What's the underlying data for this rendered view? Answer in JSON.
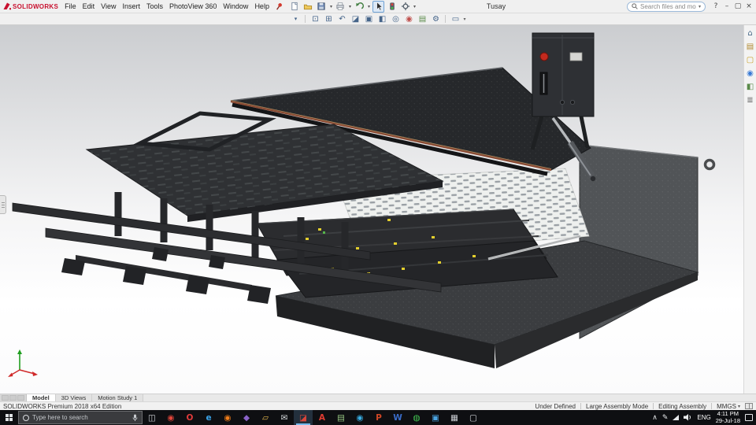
{
  "colors": {
    "solidworks_red": "#c8102e",
    "taskbar_bg": "#0e0f12",
    "active_app_underline": "#76b9ed",
    "viewport_bg_top": "#cbcdd0",
    "viewport_bg_bottom": "#ffffff",
    "model_housing": "#515457",
    "model_canopy": "#26282b",
    "model_trim_copper": "#8a4a33",
    "model_marker_yellow": "#e3cf2e"
  },
  "titlebar": {
    "logo_text": "SOLIDWORKS",
    "menus": [
      "File",
      "Edit",
      "View",
      "Insert",
      "Tools",
      "PhotoView 360",
      "Window",
      "Help"
    ],
    "document_title": "Tusay",
    "search_placeholder": "Search files and models",
    "window_controls": [
      {
        "name": "help-button",
        "glyph": "?"
      },
      {
        "name": "minimize-button",
        "glyph": "–"
      },
      {
        "name": "maximize-button",
        "glyph": "▢"
      },
      {
        "name": "close-button",
        "glyph": "×"
      }
    ]
  },
  "view_toolbar": {
    "icons": [
      {
        "name": "zoom-fit-icon",
        "glyph": "⊡"
      },
      {
        "name": "zoom-area-icon",
        "glyph": "⊞"
      },
      {
        "name": "previous-view-icon",
        "glyph": "↶"
      },
      {
        "name": "section-view-icon",
        "glyph": "◪"
      },
      {
        "name": "view-orientation-icon",
        "glyph": "▣"
      },
      {
        "name": "display-style-icon",
        "glyph": "◧"
      },
      {
        "name": "hide-show-icon",
        "glyph": "◎"
      },
      {
        "name": "edit-appearance-icon",
        "glyph": "◉",
        "color": "#c0504d"
      },
      {
        "name": "apply-scene-icon",
        "glyph": "▤",
        "color": "#5a8a4a"
      },
      {
        "name": "view-settings-icon",
        "glyph": "⚙"
      }
    ]
  },
  "task_pane": {
    "icons": [
      {
        "name": "home-icon",
        "glyph": "⌂",
        "color": "#4a6b8a"
      },
      {
        "name": "design-library-icon",
        "glyph": "▤",
        "color": "#b08a30"
      },
      {
        "name": "file-explorer-icon",
        "glyph": "▢",
        "color": "#c9a12c"
      },
      {
        "name": "appearances-icon",
        "glyph": "◉",
        "color": "#3a7bd5"
      },
      {
        "name": "scene-icon",
        "glyph": "◧",
        "color": "#5a8a4a"
      },
      {
        "name": "custom-properties-icon",
        "glyph": "≣",
        "color": "#666666"
      }
    ]
  },
  "document_tabs": {
    "tabs": [
      {
        "label": "Model",
        "active": true
      },
      {
        "label": "3D Views",
        "active": false
      },
      {
        "label": "Motion Study 1",
        "active": false
      }
    ]
  },
  "statusbar": {
    "edition": "SOLIDWORKS Premium 2018 x64 Edition",
    "constraint_status": "Under Defined",
    "assembly_mode": "Large Assembly Mode",
    "editing_state": "Editing Assembly",
    "units": "MMGS"
  },
  "taskbar": {
    "search_placeholder": "Type here to search",
    "apps": [
      {
        "name": "task-view-icon",
        "glyph": "◫",
        "color": "#cfd3d8"
      },
      {
        "name": "chrome-icon",
        "glyph": "◉",
        "color": "#e0453a"
      },
      {
        "name": "opera-icon",
        "glyph": "O",
        "color": "#e23b3b"
      },
      {
        "name": "internet-explorer-icon",
        "glyph": "e",
        "color": "#3ba3e8"
      },
      {
        "name": "firefox-icon",
        "glyph": "◉",
        "color": "#ef7d1a"
      },
      {
        "name": "visual-studio-icon",
        "glyph": "◆",
        "color": "#8a63c9"
      },
      {
        "name": "file-explorer-icon",
        "glyph": "▱",
        "color": "#e3b84e"
      },
      {
        "name": "mail-icon",
        "glyph": "✉",
        "color": "#d8dbde"
      },
      {
        "name": "solidworks-icon",
        "glyph": "◪",
        "color": "#d8453a",
        "active": true
      },
      {
        "name": "acrobat-icon",
        "glyph": "A",
        "color": "#e03c31"
      },
      {
        "name": "notepad-icon",
        "glyph": "▤",
        "color": "#9fd08a"
      },
      {
        "name": "skype-icon",
        "glyph": "◉",
        "color": "#38ade2"
      },
      {
        "name": "powerpoint-icon",
        "glyph": "P",
        "color": "#d04726"
      },
      {
        "name": "word-icon",
        "glyph": "W",
        "color": "#3a6cc9"
      },
      {
        "name": "whatsapp-icon",
        "glyph": "◍",
        "color": "#43c553"
      },
      {
        "name": "photos-icon",
        "glyph": "▣",
        "color": "#4aa3e0"
      },
      {
        "name": "calculator-icon",
        "glyph": "▦",
        "color": "#cfd3d8"
      },
      {
        "name": "snipping-tool-icon",
        "glyph": "▢",
        "color": "#cfd3d8"
      }
    ],
    "tray": {
      "language": "ENG",
      "time": "4:11 PM",
      "date": "29-Jul-18"
    }
  }
}
